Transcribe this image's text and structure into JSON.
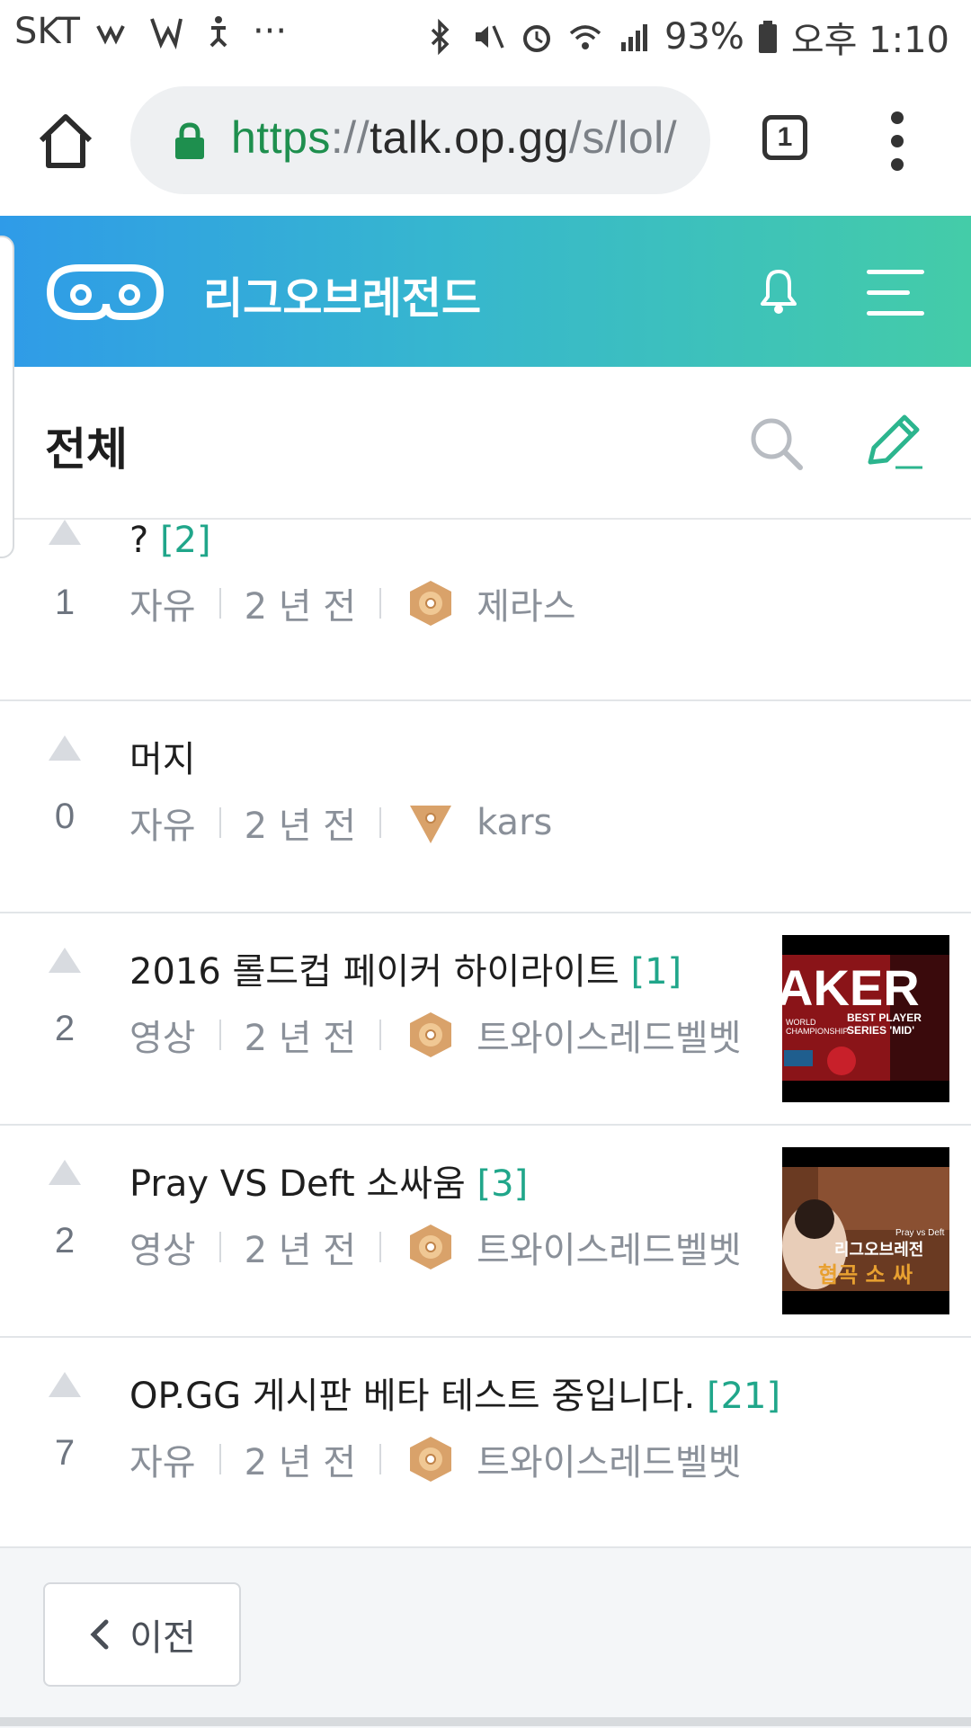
{
  "status_bar": {
    "carrier": "SKT",
    "battery": "93%",
    "time": "오후 1:10",
    "more": "···"
  },
  "browser": {
    "url_scheme": "https",
    "url_sep": "://",
    "url_host": "talk.op.gg",
    "url_path": "/s/lol/",
    "tab_count": "1"
  },
  "app": {
    "title": "리그오브레전드",
    "brand_gradient": [
      "#2f9be8",
      "#44cca8"
    ]
  },
  "board": {
    "title": "전체"
  },
  "posts": [
    {
      "votes": "1",
      "title": "?",
      "comments": "[2]",
      "category": "자유",
      "time": "2 년 전",
      "author": "제라스",
      "tier_icon": "hexagon-bronze-badge-icon",
      "has_thumb": false
    },
    {
      "votes": "0",
      "title": "머지",
      "comments": "",
      "category": "자유",
      "time": "2 년 전",
      "author": "kars",
      "tier_icon": "triangle-bronze-badge-icon",
      "has_thumb": false
    },
    {
      "votes": "2",
      "title": "2016 롤드컵 페이커 하이라이트",
      "comments": "[1]",
      "category": "영상",
      "time": "2 년 전",
      "author": "트와이스레드벨벳",
      "tier_icon": "hexagon-bronze-badge-icon",
      "has_thumb": true
    },
    {
      "votes": "2",
      "title": "Pray VS Deft 소싸움",
      "comments": "[3]",
      "category": "영상",
      "time": "2 년 전",
      "author": "트와이스레드벨벳",
      "tier_icon": "hexagon-bronze-badge-icon",
      "has_thumb": true
    },
    {
      "votes": "7",
      "title": "OP.GG 게시판 베타 테스트 중입니다.",
      "comments": "[21]",
      "category": "자유",
      "time": "2 년 전",
      "author": "트와이스레드벨벳",
      "tier_icon": "hexagon-bronze-badge-icon",
      "has_thumb": false
    }
  ],
  "thumb_text": {
    "faker_main": "AKER",
    "faker_sub1": "BEST PLAYER",
    "faker_sub2": "SERIES 'MID'",
    "faker_sub3": "WORLD",
    "faker_sub4": "CHAMPIONSHIP",
    "pray_top": "Pray vs Deft",
    "pray_mid": "리그오브레전",
    "pray_bottom": "협곡 소 싸"
  },
  "footer": {
    "prev_label": "이전"
  }
}
